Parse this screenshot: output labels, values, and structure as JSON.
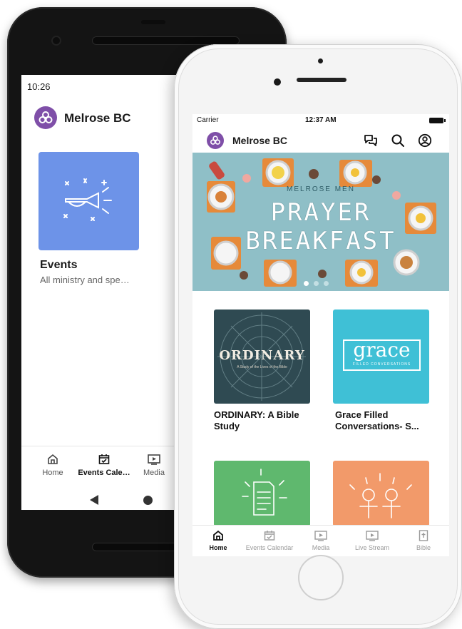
{
  "android": {
    "status_time": "10:26",
    "brand": "Melrose BC",
    "card": {
      "title": "Events",
      "subtitle": "All ministry and spe…"
    },
    "tabs": [
      {
        "label": "Home",
        "icon": "home-icon",
        "active": false
      },
      {
        "label": "Events Cale…",
        "icon": "calendar-icon",
        "active": true
      },
      {
        "label": "Media",
        "icon": "media-icon",
        "active": false
      }
    ]
  },
  "iphone": {
    "status": {
      "carrier": "Carrier",
      "time": "12:37 AM"
    },
    "brand": "Melrose BC",
    "header_icons": [
      "chat-icon",
      "search-icon",
      "profile-icon"
    ],
    "hero": {
      "kicker": "MELROSE MEN",
      "line1": "PRAYER",
      "line2": "BREAKFAST",
      "slides": 3,
      "active_slide": 0
    },
    "tiles": [
      {
        "title": "ORDINARY: A Bible Study",
        "image_text": "ORDINARY",
        "image_caption": "A Study of the Lives of the Bible",
        "color": "#2f4a52"
      },
      {
        "title": "Grace Filled Conversations- S...",
        "image_text": "grace",
        "image_caption": "FILLED CONVERSATIONS",
        "color": "#3fc0d6"
      },
      {
        "title": "",
        "color": "#5fb86e"
      },
      {
        "title": "",
        "color": "#f29a6a"
      }
    ],
    "tabs": [
      {
        "label": "Home",
        "icon": "home-icon",
        "active": true
      },
      {
        "label": "Events Calendar",
        "icon": "calendar-icon",
        "active": false
      },
      {
        "label": "Media",
        "icon": "media-icon",
        "active": false
      },
      {
        "label": "Live Stream",
        "icon": "live-stream-icon",
        "active": false
      },
      {
        "label": "Bible",
        "icon": "bible-icon",
        "active": false
      }
    ]
  },
  "colors": {
    "brand_purple": "#7f4fa8",
    "events_blue": "#6d93e8",
    "hero_teal": "#8fbfc7"
  }
}
